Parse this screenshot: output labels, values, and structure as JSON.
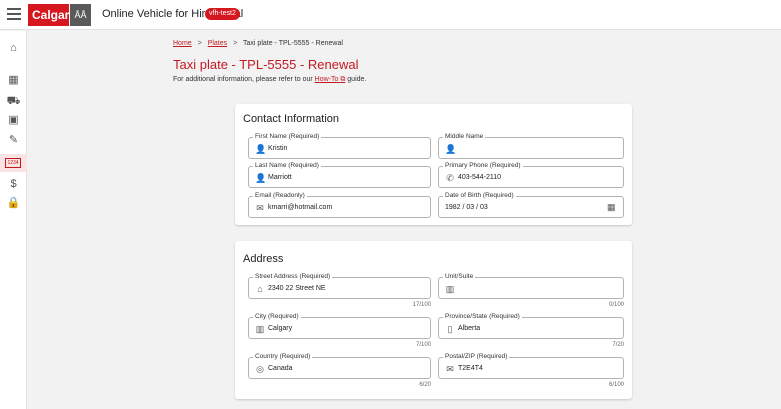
{
  "header": {
    "logo_text": "Calgary",
    "logo2_text": "ÅÅ",
    "app_title": "Online Vehicle for Hire Portal",
    "env_badge": "vfh-test2"
  },
  "sidebar": {
    "items": [
      {
        "name": "home",
        "glyph": "⌂"
      },
      {
        "name": "business",
        "glyph": "▦"
      },
      {
        "name": "vehicle",
        "glyph": "⛟"
      },
      {
        "name": "transit",
        "glyph": "▣"
      },
      {
        "name": "wrench",
        "glyph": "✎"
      },
      {
        "name": "plate",
        "glyph": "▭"
      },
      {
        "name": "dollar",
        "glyph": "$"
      },
      {
        "name": "lock",
        "glyph": "🔒"
      }
    ],
    "plate_icon_text": "1234"
  },
  "breadcrumb": {
    "home": "Home",
    "plates": "Plates",
    "current": "Taxi plate - TPL-5555 - Renewal",
    "separator": ">"
  },
  "page": {
    "title": "Taxi plate - TPL-5555 - Renewal",
    "subtitle_prefix": "For additional information, please refer to our",
    "subtitle_link": "How-To",
    "subtitle_suffix": "guide."
  },
  "contact": {
    "title": "Contact Information",
    "first_name": {
      "label": "First Name (Required)",
      "value": "Kristin"
    },
    "middle_name": {
      "label": "Middle Name",
      "value": ""
    },
    "last_name": {
      "label": "Last Name (Required)",
      "value": "Marriott"
    },
    "primary_phone": {
      "label": "Primary Phone (Required)",
      "value": "403-544-2110"
    },
    "email": {
      "label": "Email (Readonly)",
      "value": "kmarri@hotmail.com"
    },
    "dob": {
      "label": "Date of Birth (Required)",
      "value": "1982 / 03 / 03"
    }
  },
  "address": {
    "title": "Address",
    "street": {
      "label": "Street Address (Required)",
      "value": "2340 22 Street NE",
      "counter": "17/100"
    },
    "unit": {
      "label": "Unit/Suite",
      "value": "",
      "counter": "0/100"
    },
    "city": {
      "label": "City (Required)",
      "value": "Calgary",
      "counter": "7/100"
    },
    "province": {
      "label": "Province/State (Required)",
      "value": "Alberta",
      "counter": "7/20"
    },
    "country": {
      "label": "Country (Required)",
      "value": "Canada",
      "counter": "6/20"
    },
    "postal": {
      "label": "Postal/ZIP (Required)",
      "value": "T2E4T4",
      "counter": "6/100"
    }
  }
}
